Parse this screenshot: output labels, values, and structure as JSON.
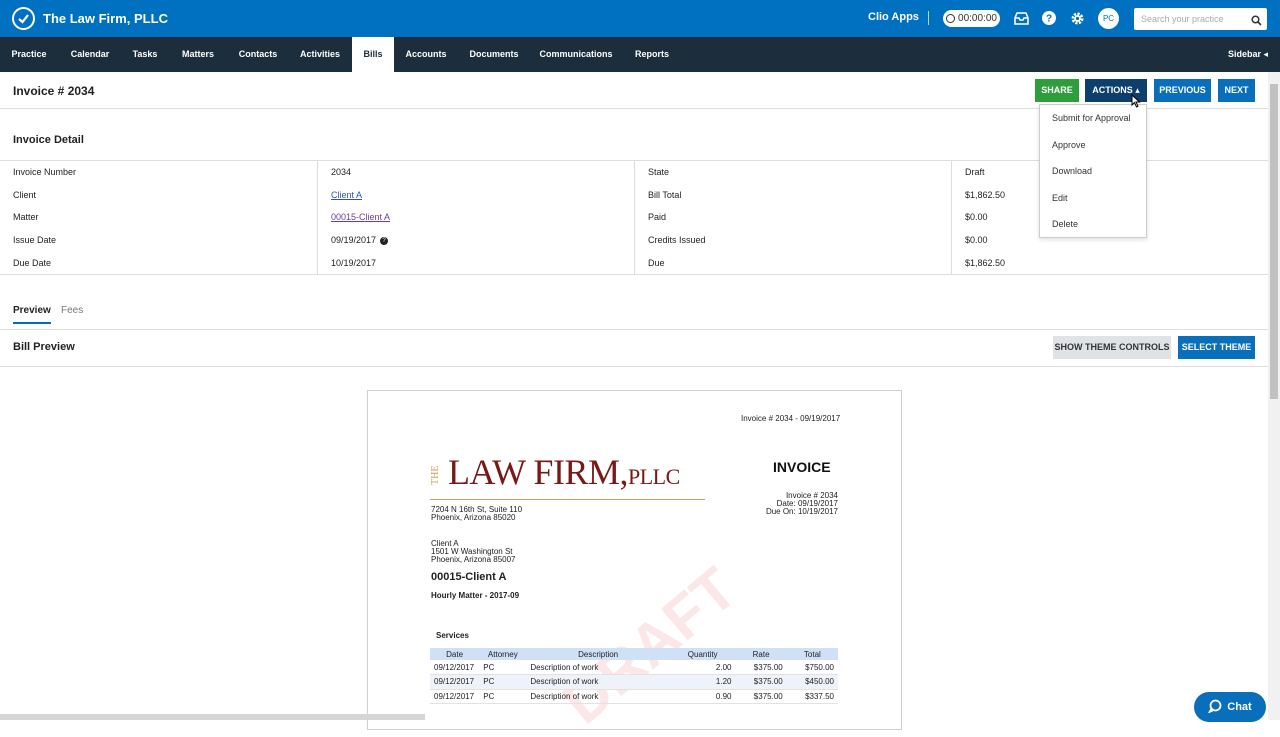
{
  "topbar": {
    "firm_name": "The Law Firm, PLLC",
    "clio_apps": "Clio Apps",
    "timer": "00:00:00",
    "avatar_initials": "PC",
    "search_placeholder": "Search your practice",
    "accent": "#0070c0"
  },
  "nav": {
    "items": [
      "Practice",
      "Calendar",
      "Tasks",
      "Matters",
      "Contacts",
      "Activities",
      "Bills",
      "Accounts",
      "Documents",
      "Communications",
      "Reports"
    ],
    "active": "Bills",
    "sidebar": "Sidebar"
  },
  "invoice": {
    "title": "Invoice # 2034",
    "buttons": {
      "share": "SHARE",
      "actions": "ACTIONS",
      "previous": "PREVIOUS",
      "next": "NEXT"
    },
    "actions_menu": [
      "Submit for Approval",
      "Approve",
      "Download",
      "Edit",
      "Delete"
    ]
  },
  "detail": {
    "heading": "Invoice Detail",
    "left": [
      {
        "label": "Invoice Number",
        "value": "2034"
      },
      {
        "label": "Client",
        "value": "Client A"
      },
      {
        "label": "Matter",
        "value": "00015-Client A"
      },
      {
        "label": "Issue Date",
        "value": "09/19/2017"
      },
      {
        "label": "Due Date",
        "value": "10/19/2017"
      }
    ],
    "right": [
      {
        "label": "State",
        "value": "Draft"
      },
      {
        "label": "Bill Total",
        "value": "$1,862.50"
      },
      {
        "label": "Paid",
        "value": "$0.00"
      },
      {
        "label": "Credits Issued",
        "value": "$0.00"
      },
      {
        "label": "Due",
        "value": "$1,862.50"
      }
    ]
  },
  "tabs": [
    "Preview",
    "Fees"
  ],
  "bill_preview": {
    "heading": "Bill Preview",
    "show_theme_controls": "SHOW THEME CONTROLS",
    "select_theme": "SELECT THEME"
  },
  "document": {
    "header_ref": "Invoice # 2034 - 09/19/2017",
    "logo_the": "THE",
    "logo_main": "LAW FIRM,",
    "logo_suffix": "PLLC",
    "address_1": "7204 N 16th St, Suite 110",
    "address_2": "Phoenix, Arizona 85020",
    "invoice_word": "INVOICE",
    "meta_1": "Invoice # 2034",
    "meta_2": "Date: 09/19/2017",
    "meta_3": "Due On: 10/19/2017",
    "client_1": "Client A",
    "client_2": "1501 W Washington St",
    "client_3": "Phoenix, Arizona 85007",
    "matter_title": "00015-Client A",
    "matter_sub": "Hourly Matter - 2017-09",
    "services_heading": "Services",
    "watermark": "DRAFT",
    "columns": [
      "Date",
      "Attorney",
      "Description",
      "Quantity",
      "Rate",
      "Total"
    ],
    "rows": [
      [
        "09/12/2017",
        "PC",
        "Description of work",
        "2.00",
        "$375.00",
        "$750.00"
      ],
      [
        "09/12/2017",
        "PC",
        "Description of work",
        "1.20",
        "$375.00",
        "$450.00"
      ],
      [
        "09/12/2017",
        "PC",
        "Description of work",
        "0.90",
        "$375.00",
        "$337.50"
      ]
    ]
  },
  "chat": "Chat"
}
